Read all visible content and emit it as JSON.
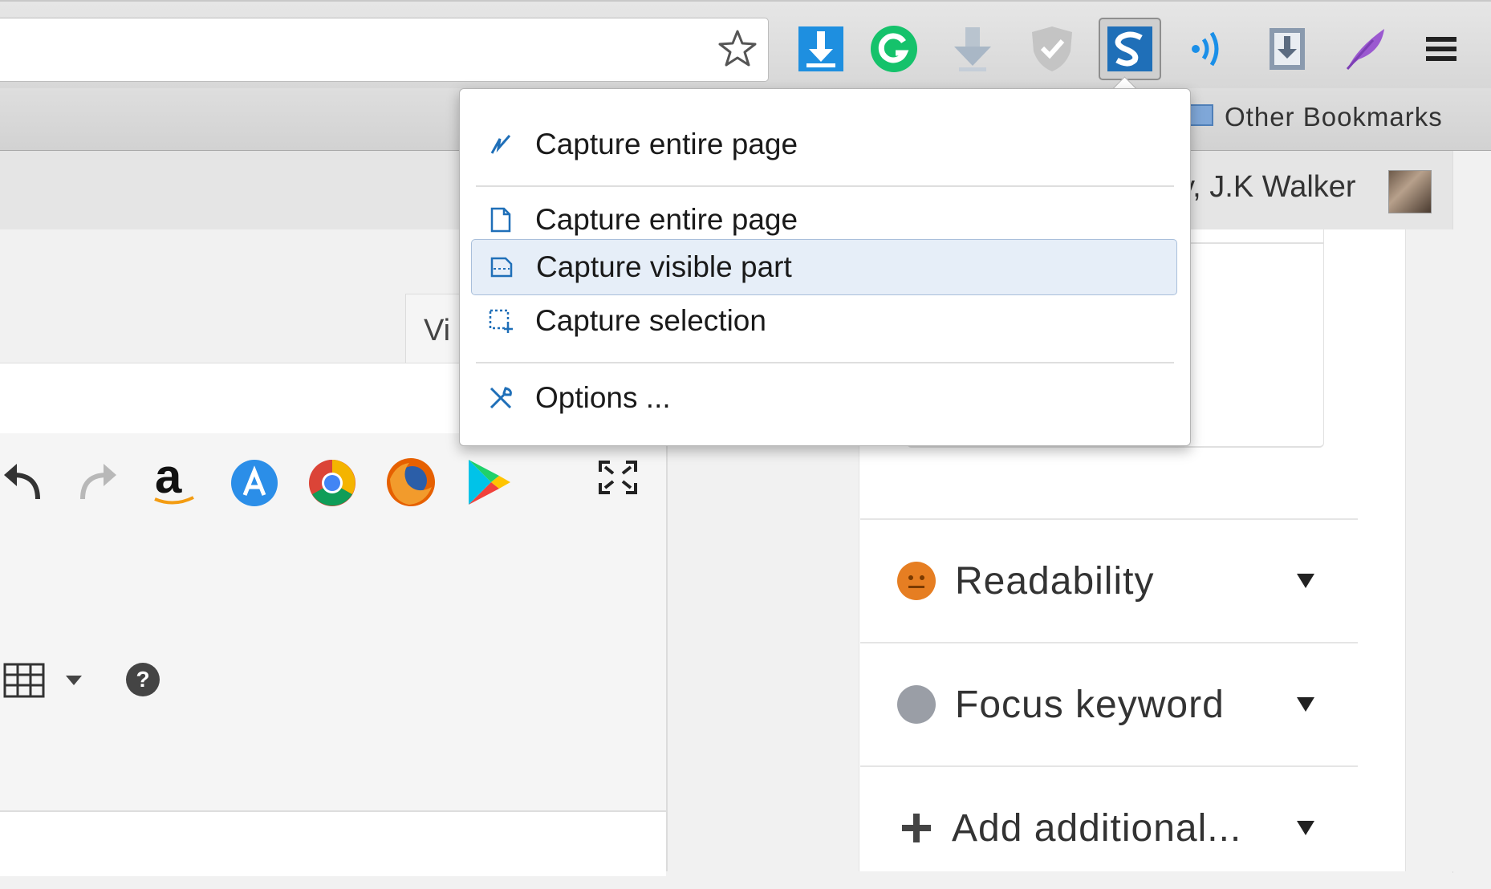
{
  "bookmarks_bar": {
    "other_bookmarks": "Other Bookmarks"
  },
  "admin_bar": {
    "user_greeting": "y, J.K Walker"
  },
  "editor": {
    "tab_visual": "Vi"
  },
  "seo_box": {
    "rows": [
      {
        "label": "Readability",
        "status_color": "#e67e22"
      },
      {
        "label": "Focus keyword",
        "status_color": "#9a9ea6"
      },
      {
        "label": "Add additional...",
        "icon": "plus-icon"
      }
    ]
  },
  "capture_menu": {
    "items": [
      {
        "label": "Capture entire page",
        "icon": "capture-entire-page-streak-icon"
      },
      {
        "label": "Capture entire page",
        "icon": "page-icon"
      },
      {
        "label": "Capture visible part",
        "icon": "visible-part-icon",
        "highlighted": true
      },
      {
        "label": "Capture selection",
        "icon": "selection-icon"
      },
      {
        "label": "Options ...",
        "icon": "tools-icon"
      }
    ]
  },
  "extensions": [
    "download-blue-icon",
    "grammarly-icon",
    "download-arrow-icon",
    "shield-check-icon",
    "screenshot-s-icon",
    "sound-waves-icon",
    "download-box-icon",
    "feather-icon",
    "menu-hamburger-icon"
  ],
  "colors": {
    "accent_blue": "#1e8fe0",
    "grammarly_green": "#15c26b",
    "menu_highlight": "#e6eef8",
    "readability_orange": "#e67e22",
    "focus_gray": "#9a9ea6"
  }
}
